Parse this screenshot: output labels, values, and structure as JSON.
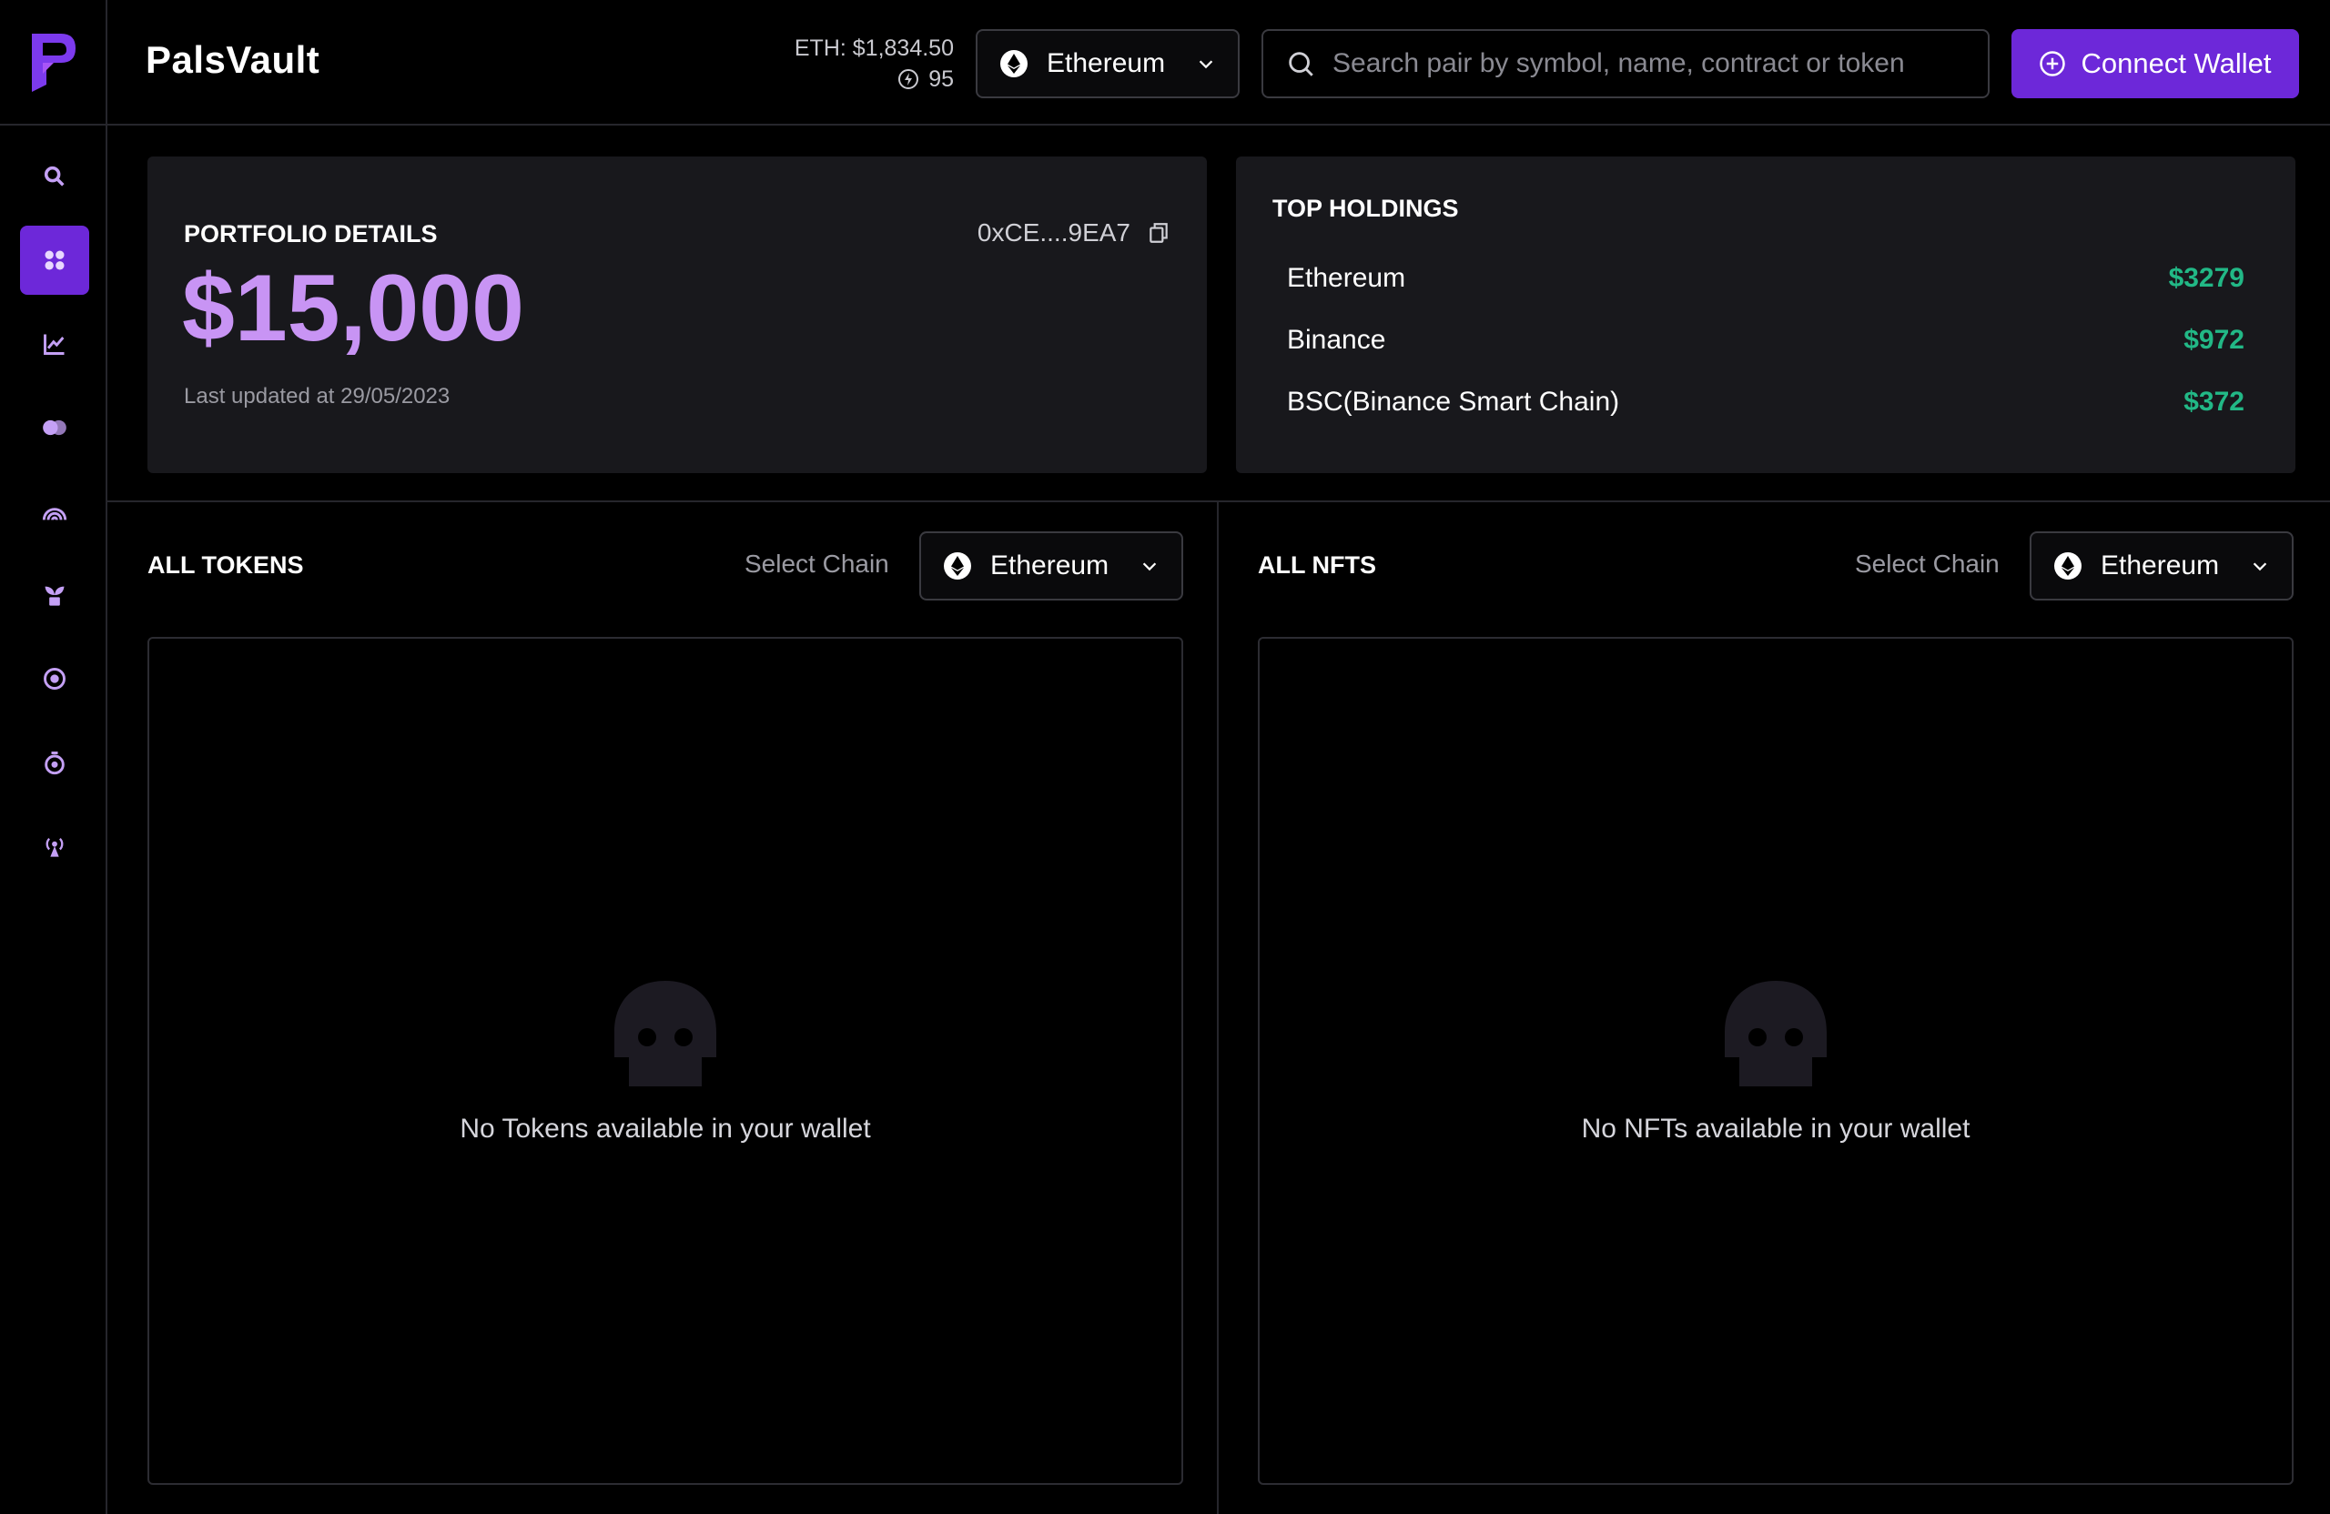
{
  "brand": "PalsVault",
  "header": {
    "eth_price": "ETH: $1,834.50",
    "gas": "95",
    "chain": "Ethereum",
    "search_placeholder": "Search pair by symbol, name, contract or token",
    "connect_label": "Connect Wallet"
  },
  "sidebar": {
    "items": [
      {
        "icon": "search-icon",
        "active": false
      },
      {
        "icon": "dashboard-icon",
        "active": true
      },
      {
        "icon": "chart-icon",
        "active": false
      },
      {
        "icon": "coins-icon",
        "active": false
      },
      {
        "icon": "rainbow-icon",
        "active": false
      },
      {
        "icon": "plant-icon",
        "active": false
      },
      {
        "icon": "target-icon",
        "active": false
      },
      {
        "icon": "timer-icon",
        "active": false
      },
      {
        "icon": "broadcast-icon",
        "active": false
      }
    ]
  },
  "portfolio": {
    "label": "PORTFOLIO DETAILS",
    "address": "0xCE....9EA7",
    "value": "$15,000",
    "updated": "Last updated at 29/05/2023"
  },
  "holdings": {
    "title": "TOP HOLDINGS",
    "items": [
      {
        "name": "Ethereum",
        "value": "$3279"
      },
      {
        "name": "Binance",
        "value": "$972"
      },
      {
        "name": "BSC(Binance Smart Chain)",
        "value": "$372"
      }
    ]
  },
  "tokens": {
    "title": "ALL TOKENS",
    "select_label": "Select Chain",
    "chain": "Ethereum",
    "empty": "No Tokens available in your wallet"
  },
  "nfts": {
    "title": "ALL NFTS",
    "select_label": "Select Chain",
    "chain": "Ethereum",
    "empty": "No NFTs available in your wallet"
  },
  "colors": {
    "accent": "#6d28d9",
    "highlight": "#c894f4",
    "positive": "#22b886"
  }
}
